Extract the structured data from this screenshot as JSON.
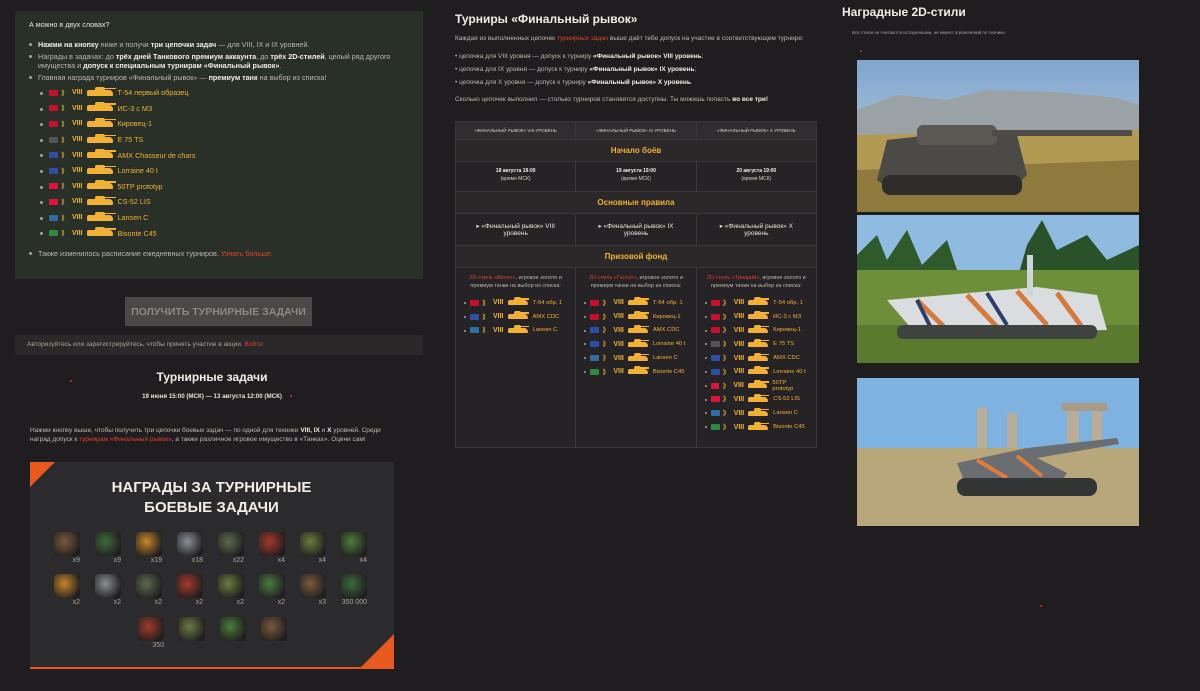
{
  "intro_panel": {
    "title": "А можно в двух словах?",
    "bullets": [
      {
        "parts": [
          "Нажми на кнопку",
          " ниже и получи ",
          "три цепочки задач",
          " — для VIII, IX и IX уровней."
        ]
      },
      {
        "parts": [
          "Награды в задачах: до ",
          "трёх дней Танкового премиум аккаунта",
          ", до ",
          "трёх 2D-стилей",
          ", целый ряд другого имущества и ",
          "допуск к специальным турнирам «Финальный рывок»",
          "."
        ]
      },
      {
        "parts": [
          "Главная награда турниров «Финальный рывок» — ",
          "премиум танк",
          " на выбор из списка!"
        ]
      }
    ],
    "tanks": [
      {
        "tier": "VIII",
        "name": "Т-54 первый образец",
        "flag": "#c8102e"
      },
      {
        "tier": "VIII",
        "name": "ИС-3 с МЗ",
        "flag": "#c8102e"
      },
      {
        "tier": "VIII",
        "name": "Кировец-1",
        "flag": "#c8102e"
      },
      {
        "tier": "VIII",
        "name": "E 75 TS",
        "flag": "#555555"
      },
      {
        "tier": "VIII",
        "name": "AMX Chasseur de chars",
        "flag": "#2e4fa3"
      },
      {
        "tier": "VIII",
        "name": "Lorraine 40 t",
        "flag": "#2e4fa3"
      },
      {
        "tier": "VIII",
        "name": "50TP prototyp",
        "flag": "#dc143c"
      },
      {
        "tier": "VIII",
        "name": "CS-52 LIS",
        "flag": "#dc143c"
      },
      {
        "tier": "VIII",
        "name": "Lansen C",
        "flag": "#2f6da3"
      },
      {
        "tier": "VIII",
        "name": "Bisonte C45",
        "flag": "#2e8b3c"
      }
    ],
    "footer": "Также изменилось расписание ежедневных турниров.",
    "footer_link": "Узнать больше."
  },
  "get_button": "ПОЛУЧИТЬ ТУРНИРНЫЕ ЗАДАЧИ",
  "auth_text": "Авторизуйтесь или зарегистрируйтесь, чтобы принять участие в акции.",
  "auth_link": "Войти",
  "tasks": {
    "title": "Турнирные задачи",
    "dates": "19 июня 15:00 (МСК) — 13 августа 12:00 (МСК)",
    "desc_1": "Нажми кнопку выше, чтобы получить три цепочки боевых задач — по одной для техники",
    "desc_tiers": "VIII, IX",
    "desc_and": "и",
    "desc_x": "X",
    "desc_2": "уровней. Среди наград допуск к",
    "desc_link": "турнирам «Финальный рывок»",
    "desc_3": ", а также различное игровое имущество в «Танках». Оцени сам!"
  },
  "reward_card": {
    "title_1": "НАГРАДЫ ЗА ТУРНИРНЫЕ",
    "title_2": "БОЕВЫЕ ЗАДАЧИ",
    "row1": [
      "x9",
      "x9",
      "x19",
      "x18",
      "x22",
      "x4",
      "x4",
      "x4"
    ],
    "row2": [
      "x2",
      "x2",
      "x2",
      "x2",
      "x2",
      "x2",
      "x3",
      "350 000"
    ],
    "row3": [
      "350",
      "",
      "",
      ""
    ]
  },
  "tournaments": {
    "title": "Турниры «Финальный рывок»",
    "intro_1": "Каждая из выполненных цепочек",
    "intro_link": "турнирных задач",
    "intro_2": "выше даёт тебе допуск на участие в соответствующем турнире:",
    "list": [
      {
        "pre": "цепочка для VIII уровня — допуск к турниру ",
        "b": "«Финальный рывок» VIII уровень",
        ";": ";"
      },
      {
        "pre": "цепочка для IX уровня — допуск к турниру ",
        "b": "«Финальный рывок» IX уровень",
        ";": ";"
      },
      {
        "pre": "цепочка для X уровня — допуск к турниру ",
        "b": "«Финальный рывок» X уровень",
        ";": "."
      }
    ],
    "outro_1": "Сколько цепочек выполнил — столько турниров становятся доступны. Ты можешь попасть",
    "outro_b": "во все три!"
  },
  "table": {
    "headers": [
      "«ФИНАЛЬНЫЙ РЫВОК» VIII УРОВЕНЬ",
      "«ФИНАЛЬНЫЙ РЫВОК» IX УРОВЕНЬ",
      "«ФИНАЛЬНЫЙ РЫВОК» X УРОВЕНЬ"
    ],
    "sec_start": "Начало боёв",
    "dates": [
      "18 августа 19:00",
      "19 августа 19:00",
      "20 августа 19:00"
    ],
    "msk": "(время МСК)",
    "sec_rules": "Основные правила",
    "rules": [
      "«Финальный рывок» VIII уровень",
      "«Финальный рывок» IX уровень",
      "«Финальный рывок» X уровень"
    ],
    "sec_prize": "Призовой фонд",
    "prize_pre": "2D-стиль",
    "prize_styles": [
      "«Велет»",
      "«Гастат»",
      "«Триарий»"
    ],
    "prize_post": ", игровое золото и премиум танки на выбор из списка:",
    "col1": [
      {
        "tier": "VIII",
        "name": "Т-54 обр. 1",
        "flag": "#c8102e"
      },
      {
        "tier": "VIII",
        "name": "AMX CDC",
        "flag": "#2e4fa3"
      },
      {
        "tier": "VIII",
        "name": "Lansen C",
        "flag": "#2f6da3"
      }
    ],
    "col2": [
      {
        "tier": "VIII",
        "name": "Т-54 обр. 1",
        "flag": "#c8102e"
      },
      {
        "tier": "VIII",
        "name": "Кировец-1",
        "flag": "#c8102e"
      },
      {
        "tier": "VIII",
        "name": "AMX CDC",
        "flag": "#2e4fa3"
      },
      {
        "tier": "VIII",
        "name": "Lorraine 40 t",
        "flag": "#2e4fa3"
      },
      {
        "tier": "VIII",
        "name": "Lansen C",
        "flag": "#2f6da3"
      },
      {
        "tier": "VIII",
        "name": "Bisonte C45",
        "flag": "#2e8b3c"
      }
    ],
    "col3": [
      {
        "tier": "VIII",
        "name": "Т-54 обр. 1",
        "flag": "#c8102e"
      },
      {
        "tier": "VIII",
        "name": "ИС-3 с МЗ",
        "flag": "#c8102e"
      },
      {
        "tier": "VIII",
        "name": "Кировец-1",
        "flag": "#c8102e"
      },
      {
        "tier": "VIII",
        "name": "E 75 TS",
        "flag": "#555555"
      },
      {
        "tier": "VIII",
        "name": "AMX CDC",
        "flag": "#2e4fa3"
      },
      {
        "tier": "VIII",
        "name": "Lorraine 40 t",
        "flag": "#2e4fa3"
      },
      {
        "tier": "VIII",
        "name": "50TP prototyp",
        "flag": "#dc143c"
      },
      {
        "tier": "VIII",
        "name": "CS-52 LIS",
        "flag": "#dc143c"
      },
      {
        "tier": "VIII",
        "name": "Lansen C",
        "flag": "#2f6da3"
      },
      {
        "tier": "VIII",
        "name": "Bisonte C45",
        "flag": "#2e8b3c"
      }
    ]
  },
  "styles": {
    "title": "Наградные 2D-стили",
    "note": "Все стили не считаются историчными, не имеют ограничений по технике."
  }
}
